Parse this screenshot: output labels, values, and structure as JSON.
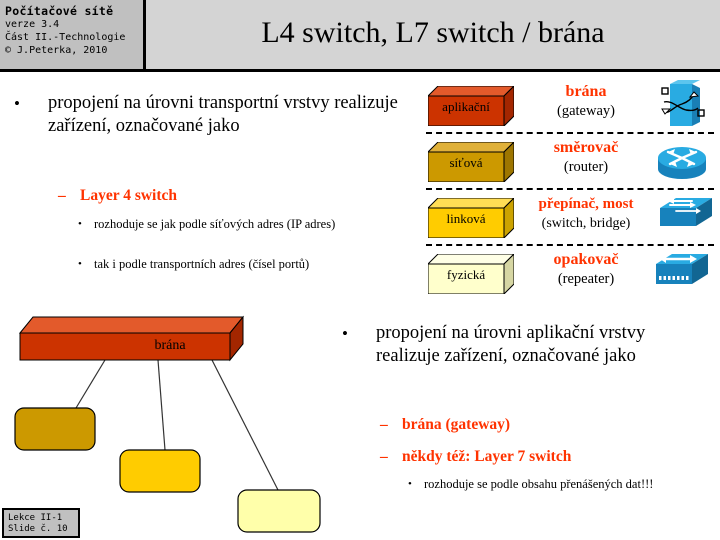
{
  "header": {
    "course_title": "Počítačové sítě",
    "version": "verze 3.4",
    "part": "Část II.-Technologie",
    "copyright": "© J.Peterka, 2010",
    "slide_title": "L4 switch, L7 switch / brána"
  },
  "left_block": {
    "bullet_char": "•",
    "main": "propojení na úrovni transportní vrstvy realizuje zařízení, označované jako",
    "sub_dash": "–",
    "sub": "Layer 4 switch",
    "sub_bullet_char": "•",
    "detail1": "rozhoduje se jak podle síťových adres (IP adres)",
    "detail2": "tak i podle transportních adres (čísel portů)"
  },
  "right_block": {
    "bullet_char": "•",
    "main": "propojení na úrovni aplikační vrstvy realizuje zařízení, označované jako",
    "sub_dash": "–",
    "sub1": "brána (gateway)",
    "sub2": "někdy též: Layer 7 switch",
    "sub_bullet_char": "•",
    "detail": "rozhoduje se podle obsahu přenášených dat!!!"
  },
  "layers": [
    {
      "layer_label": "aplikační",
      "device_cz": "brána",
      "device_en": "(gateway)",
      "icon": "gateway-icon",
      "face_color": "#CC3300",
      "top_color": "#E35A2B",
      "side_color": "#A32600"
    },
    {
      "layer_label": "síťová",
      "device_cz": "směrovač",
      "device_en": "(router)",
      "icon": "router-icon",
      "face_color": "#CC9900",
      "top_color": "#E0B13A",
      "side_color": "#9E7600"
    },
    {
      "layer_label": "linková",
      "device_cz": "přepínač, most",
      "device_en": "(switch, bridge)",
      "icon": "switch-icon",
      "face_color": "#FFCC00",
      "top_color": "#FFDD55",
      "side_color": "#CCA300"
    },
    {
      "layer_label": "fyzická",
      "device_cz": "opakovač",
      "device_en": "(repeater)",
      "icon": "repeater-icon",
      "face_color": "#FFFFCC",
      "top_color": "#FFFFE6",
      "side_color": "#D6D6A3"
    }
  ],
  "diagram": {
    "gateway_label": "brána",
    "gateway_color": "#CC3300",
    "nodes": [
      {
        "name": "node-1",
        "color": "#CC9900"
      },
      {
        "name": "node-2",
        "color": "#FFCC00"
      },
      {
        "name": "node-3",
        "color": "#FFFFAA"
      }
    ]
  },
  "footer": {
    "lecture": "Lekce II-1",
    "slide_no": "Slide č. 10"
  },
  "colors": {
    "accent_red": "#FF3300",
    "header_gray": "#C0C0C0",
    "title_bar_gray": "#D4D4D4",
    "cisco_blue": "#1CA0E3"
  }
}
